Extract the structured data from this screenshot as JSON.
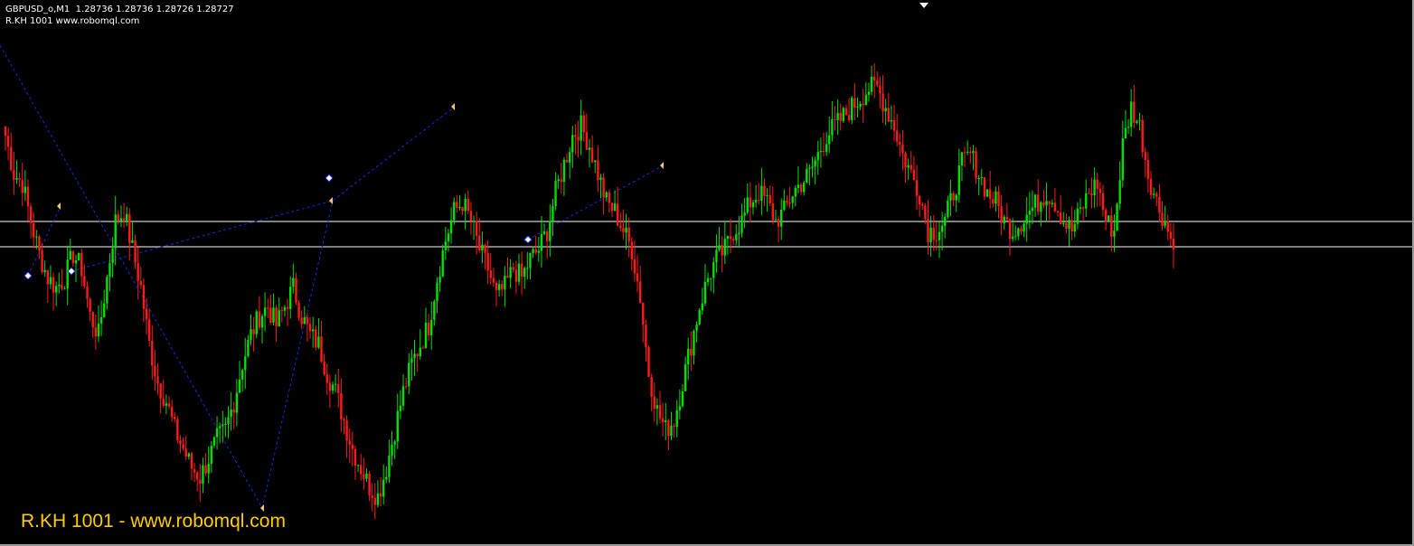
{
  "header": {
    "symbol_line": "GBPUSD_o,M1  1.28736 1.28736 1.28726 1.28727",
    "indicator_line": "R.KH 1001 www.robomql.com"
  },
  "watermark": "R.KH 1001 - www.robomql.com",
  "colors": {
    "background": "#000000",
    "bull": "#00e000",
    "bear": "#ff1a1a",
    "zigzag": "#1a2bd6",
    "level_lines": "#ffffff",
    "watermark": "#ffcc00"
  },
  "scroll_marker_icon": "triangle-down-icon",
  "horizontal_levels_count": 2,
  "chart_data": {
    "type": "candlestick",
    "timeframe": "M1",
    "symbol": "GBPUSD_o",
    "last_quote": {
      "open": 1.28736,
      "high": 1.28736,
      "low": 1.28726,
      "close": 1.28727
    },
    "closes_relative": [
      0.8,
      0.72,
      0.7,
      0.62,
      0.55,
      0.5,
      0.48,
      0.5,
      0.55,
      0.52,
      0.42,
      0.38,
      0.5,
      0.62,
      0.64,
      0.56,
      0.48,
      0.36,
      0.28,
      0.24,
      0.18,
      0.14,
      0.1,
      0.08,
      0.12,
      0.16,
      0.18,
      0.24,
      0.32,
      0.38,
      0.42,
      0.44,
      0.4,
      0.44,
      0.48,
      0.42,
      0.38,
      0.36,
      0.3,
      0.26,
      0.2,
      0.14,
      0.1,
      0.06,
      0.04,
      0.1,
      0.18,
      0.26,
      0.32,
      0.36,
      0.4,
      0.5,
      0.58,
      0.64,
      0.66,
      0.62,
      0.56,
      0.52,
      0.46,
      0.48,
      0.52,
      0.5,
      0.54,
      0.56,
      0.6,
      0.68,
      0.74,
      0.8,
      0.82,
      0.78,
      0.72,
      0.66,
      0.64,
      0.6,
      0.56,
      0.46,
      0.3,
      0.22,
      0.18,
      0.2,
      0.28,
      0.36,
      0.44,
      0.5,
      0.54,
      0.56,
      0.6,
      0.62,
      0.66,
      0.68,
      0.66,
      0.62,
      0.64,
      0.68,
      0.7,
      0.72,
      0.76,
      0.8,
      0.82,
      0.84,
      0.86,
      0.88,
      0.9,
      0.9,
      0.86,
      0.82,
      0.76,
      0.72,
      0.68,
      0.6,
      0.6,
      0.62,
      0.68,
      0.74,
      0.76,
      0.72,
      0.68,
      0.66,
      0.62,
      0.6,
      0.62,
      0.64,
      0.66,
      0.68,
      0.66,
      0.62,
      0.6,
      0.64,
      0.68,
      0.7,
      0.62,
      0.6,
      0.78,
      0.86,
      0.82,
      0.72,
      0.66,
      0.62,
      0.56
    ]
  }
}
